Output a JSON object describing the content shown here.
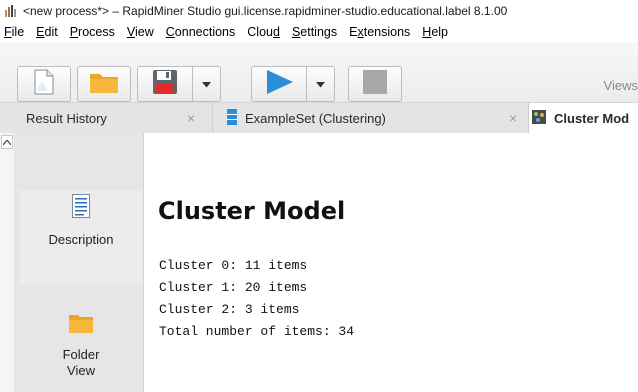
{
  "window": {
    "title": "<new process*> – RapidMiner Studio gui.license.rapidminer-studio.educational.label 8.1.00"
  },
  "menu": {
    "items": [
      {
        "mn": "F",
        "rest": "ile"
      },
      {
        "mn": "E",
        "rest": "dit"
      },
      {
        "mn": "P",
        "rest": "rocess"
      },
      {
        "mn": "V",
        "rest": "iew"
      },
      {
        "mn": "C",
        "rest": "onnections"
      },
      {
        "mn": "",
        "pre": "Clou",
        "mn2": "d"
      },
      {
        "mn": "S",
        "rest": "ettings"
      },
      {
        "pre": "E",
        "mn2": "x",
        "rest2": "tensions"
      },
      {
        "mn": "H",
        "rest": "elp"
      }
    ]
  },
  "toolbar": {
    "views_label": "Views"
  },
  "tabs": [
    {
      "label": "Result History",
      "close": "×"
    },
    {
      "label": "ExampleSet (Clustering)",
      "close": "×"
    },
    {
      "label": "Cluster Mod"
    }
  ],
  "left_panel": {
    "items": [
      {
        "label": "Description"
      },
      {
        "label": "Folder View"
      }
    ]
  },
  "main": {
    "title": "Cluster Model",
    "lines": [
      "Cluster 0: 11 items",
      "Cluster 1: 20 items",
      "Cluster 2: 3 items",
      "Total number of items: 34"
    ]
  },
  "colors": {
    "play_blue": "#2a8fd8",
    "folder_yellow": "#f6b73c",
    "save_red": "#e02b2b"
  }
}
